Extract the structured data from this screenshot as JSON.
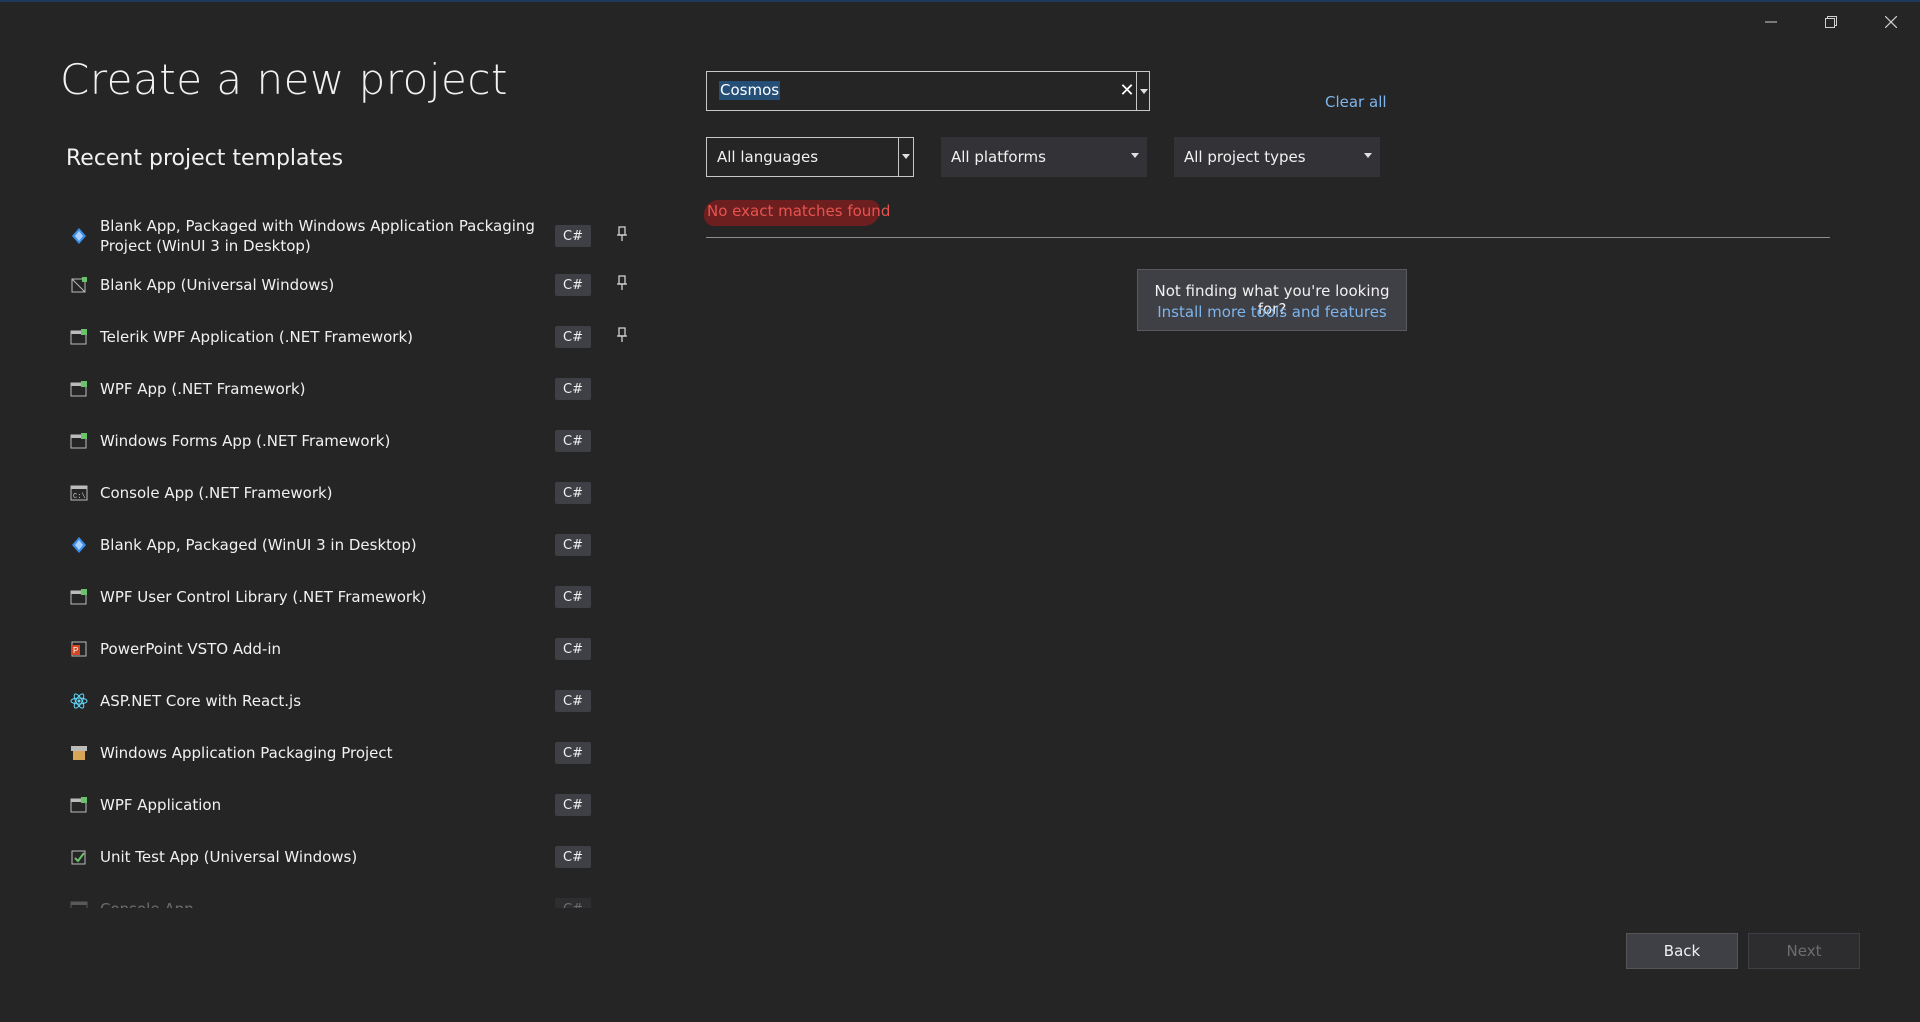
{
  "header": {
    "title": "Create a new project"
  },
  "recent": {
    "title": "Recent project templates",
    "items": [
      {
        "name": "Blank App, Packaged with Windows Application Packaging Project (WinUI 3 in Desktop)",
        "lang": "C#",
        "icon": "winui-icon",
        "pinned": true
      },
      {
        "name": "Blank App (Universal Windows)",
        "lang": "C#",
        "icon": "uwp-app-icon",
        "pinned": true
      },
      {
        "name": "Telerik WPF Application (.NET Framework)",
        "lang": "C#",
        "icon": "telerik-wpf-icon",
        "pinned": true
      },
      {
        "name": "WPF App (.NET Framework)",
        "lang": "C#",
        "icon": "wpf-app-icon",
        "pinned": false
      },
      {
        "name": "Windows Forms App (.NET Framework)",
        "lang": "C#",
        "icon": "winforms-icon",
        "pinned": false
      },
      {
        "name": "Console App (.NET Framework)",
        "lang": "C#",
        "icon": "console-icon",
        "pinned": false
      },
      {
        "name": "Blank App, Packaged (WinUI 3 in Desktop)",
        "lang": "C#",
        "icon": "winui-icon",
        "pinned": false
      },
      {
        "name": "WPF User Control Library (.NET Framework)",
        "lang": "C#",
        "icon": "wpf-control-library-icon",
        "pinned": false
      },
      {
        "name": "PowerPoint VSTO Add-in",
        "lang": "C#",
        "icon": "powerpoint-icon",
        "pinned": false
      },
      {
        "name": "ASP.NET Core with React.js",
        "lang": "C#",
        "icon": "react-icon",
        "pinned": false
      },
      {
        "name": "Windows Application Packaging Project",
        "lang": "C#",
        "icon": "package-icon",
        "pinned": false
      },
      {
        "name": "WPF Application",
        "lang": "C#",
        "icon": "wpf-app-icon",
        "pinned": false
      },
      {
        "name": "Unit Test App (Universal Windows)",
        "lang": "C#",
        "icon": "unit-test-icon",
        "pinned": false
      },
      {
        "name": "Console App",
        "lang": "C#",
        "icon": "console-icon",
        "pinned": false
      }
    ]
  },
  "search": {
    "value": "Cosmos",
    "clear_all": "Clear all"
  },
  "filters": {
    "languages": "All languages",
    "platforms": "All platforms",
    "project_types": "All project types"
  },
  "results": {
    "no_match": "No exact matches found",
    "tip_text": "Not finding what you're looking for?",
    "tip_link": "Install more tools and features"
  },
  "footer": {
    "back": "Back",
    "next": "Next"
  },
  "colors": {
    "background": "#252526",
    "accent_link": "#7db5ec",
    "error": "#e8534f",
    "selection": "#264f78"
  }
}
